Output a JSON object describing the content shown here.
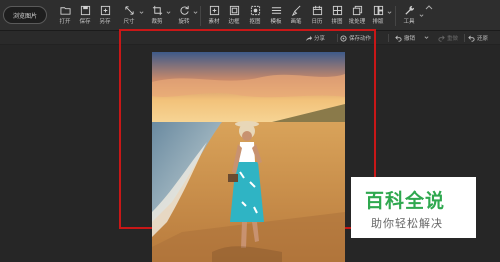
{
  "toolbar": {
    "browse_label": "浏览图片",
    "tools": [
      {
        "label": "打开",
        "icon": "open-icon"
      },
      {
        "label": "保存",
        "icon": "save-icon"
      },
      {
        "label": "另存",
        "icon": "save-as-icon"
      },
      {
        "label": "尺寸",
        "icon": "resize-icon"
      },
      {
        "label": "裁剪",
        "icon": "crop-icon"
      },
      {
        "label": "旋转",
        "icon": "rotate-icon"
      },
      {
        "label": "素材",
        "icon": "material-icon"
      },
      {
        "label": "边框",
        "icon": "border-icon"
      },
      {
        "label": "抠图",
        "icon": "cutout-icon"
      },
      {
        "label": "模板",
        "icon": "template-icon"
      },
      {
        "label": "画笔",
        "icon": "brush-icon"
      },
      {
        "label": "日历",
        "icon": "calendar-icon"
      },
      {
        "label": "拼图",
        "icon": "collage-icon"
      },
      {
        "label": "批处理",
        "icon": "batch-icon"
      },
      {
        "label": "排版",
        "icon": "layout-icon"
      },
      {
        "label": "工具",
        "icon": "tools-icon"
      }
    ]
  },
  "actions": {
    "share": "分享",
    "save_action": "保存动作",
    "undo": "撤销",
    "redo": "重做",
    "restore": "还原"
  },
  "watermark": {
    "title": "百科全说",
    "subtitle": "助你轻松解决",
    "color": "#2fa84f"
  },
  "colors": {
    "toolbar_bg": "#2e2e2e",
    "canvas_bg": "#262626",
    "selection_frame": "#c81717"
  }
}
